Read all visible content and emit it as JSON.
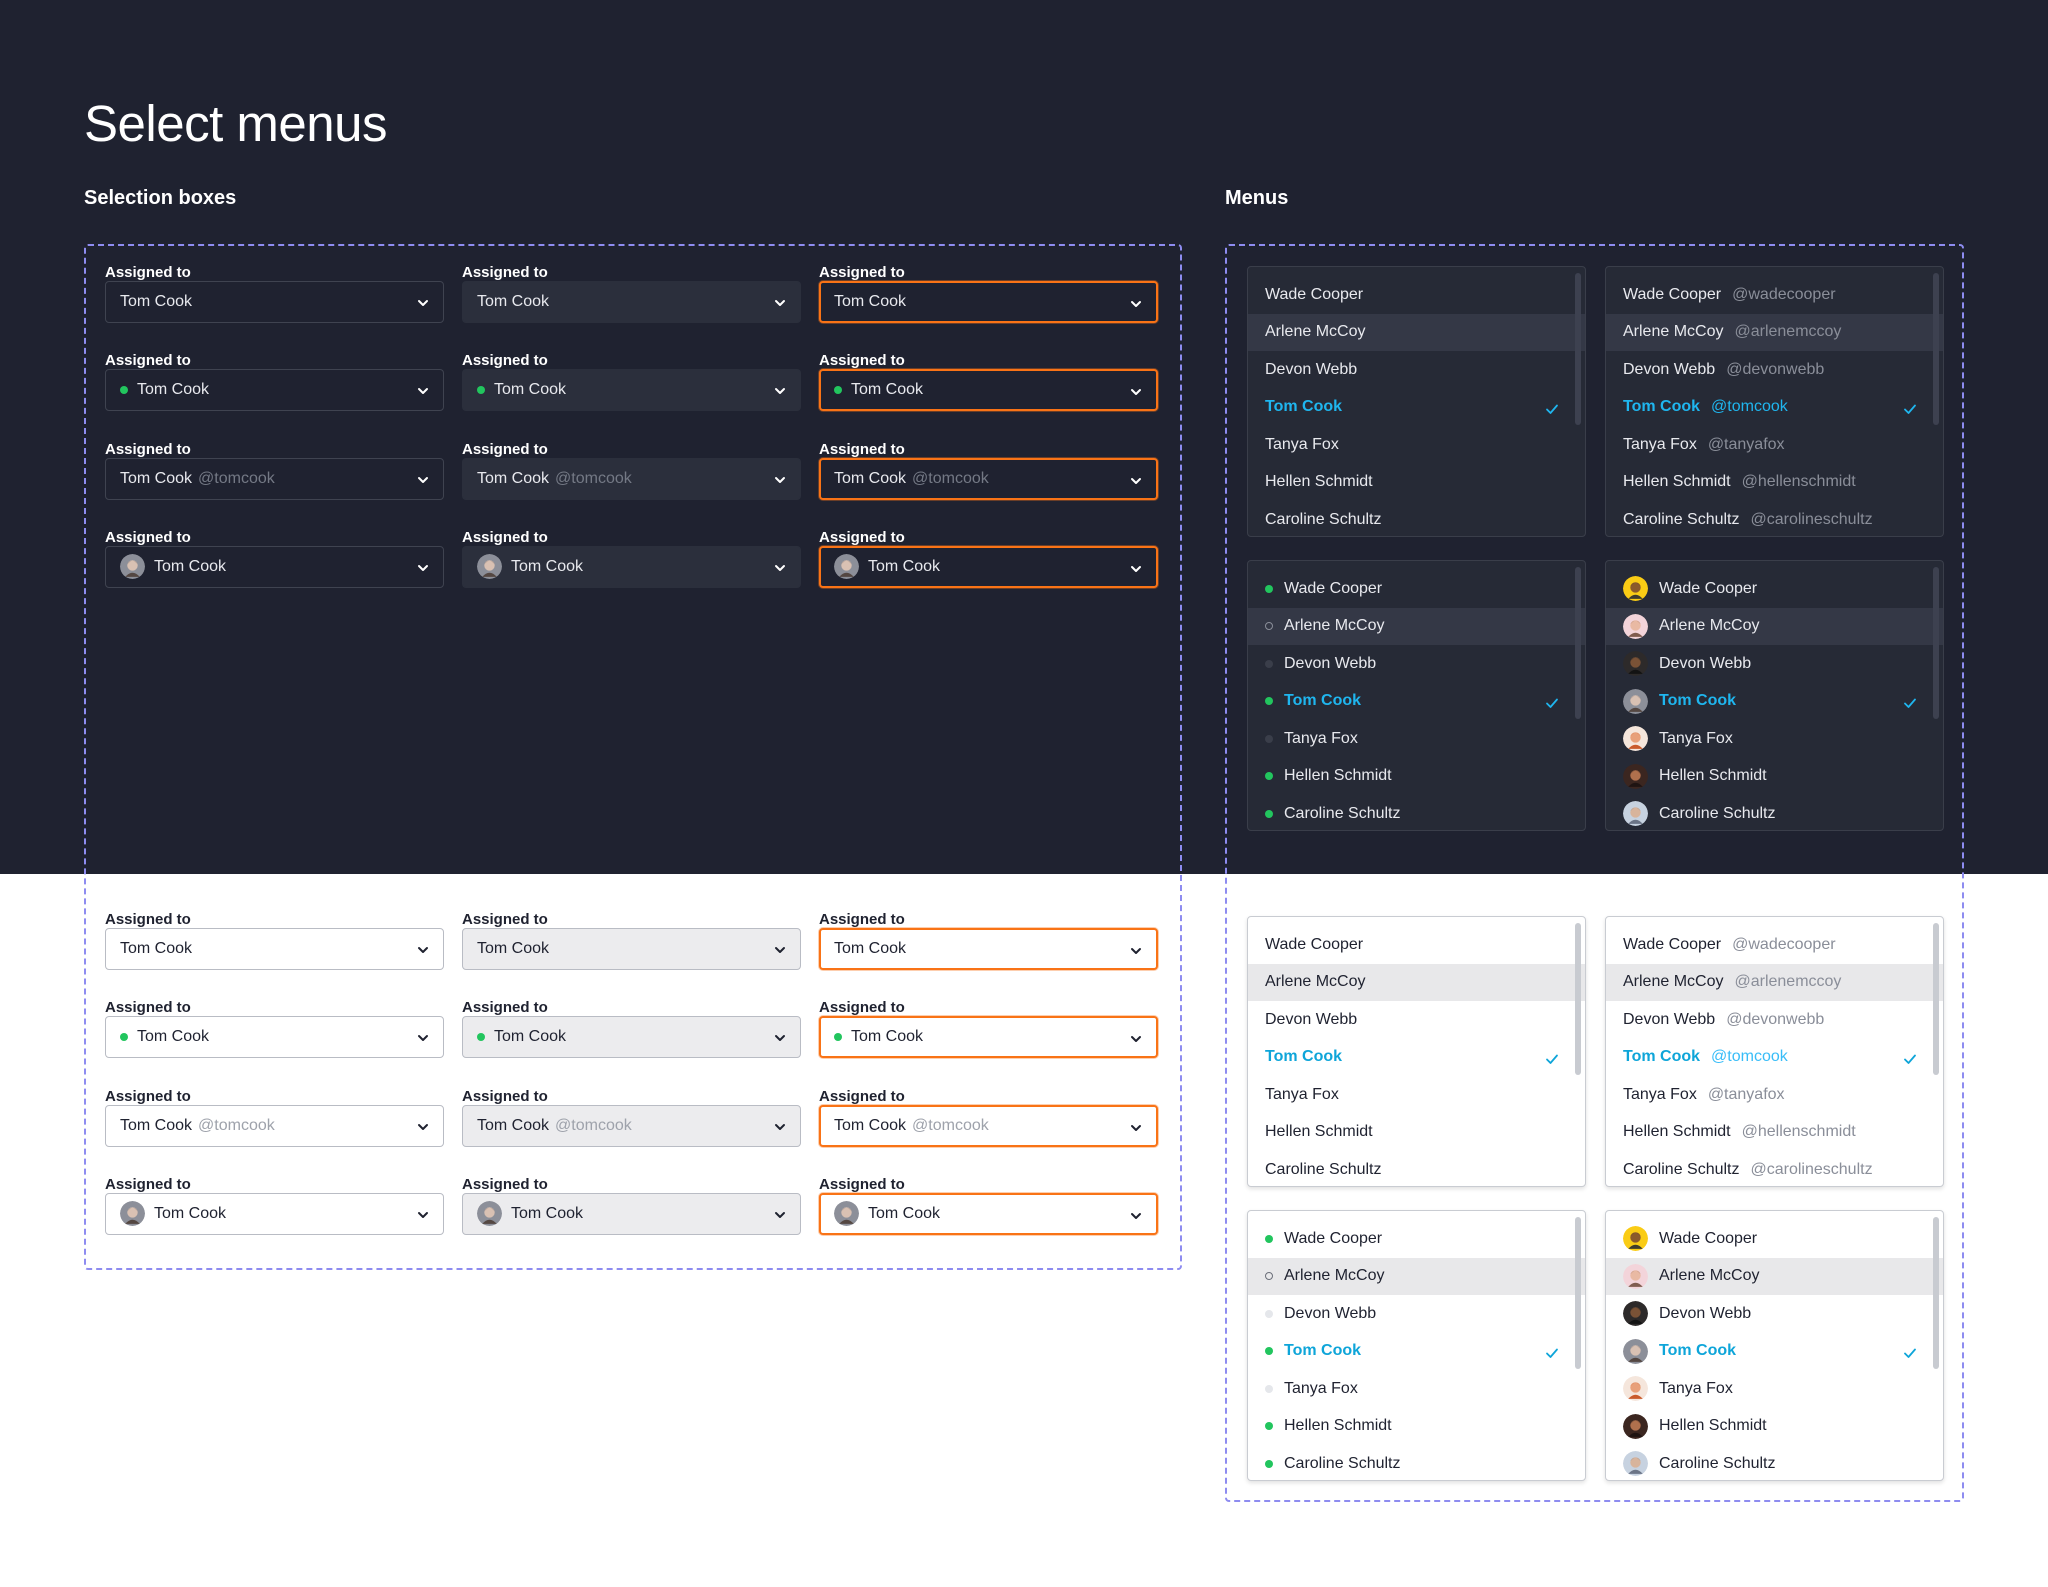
{
  "page": {
    "title": "Select menus"
  },
  "sections": {
    "selection_boxes": "Selection boxes",
    "menus": "Menus"
  },
  "colors": {
    "dark_bg": "#1f2230",
    "dark_fill": "#2b2f3c",
    "focus_ring": "#f97316",
    "online": "#22c55e",
    "selected_dark": "#1fb6ef",
    "selected_light": "#0ea5d9",
    "frame_dash": "#8e8cf0"
  },
  "field": {
    "label": "Assigned to",
    "value": "Tom Cook",
    "handle": "@tomcook"
  },
  "selection_rows": [
    {
      "variant": "plain"
    },
    {
      "variant": "status"
    },
    {
      "variant": "handle"
    },
    {
      "variant": "avatar"
    }
  ],
  "selection_columns": [
    {
      "state": "default"
    },
    {
      "state": "filled"
    },
    {
      "state": "focused"
    }
  ],
  "people": [
    {
      "name": "Wade Cooper",
      "handle": "@wadecooper",
      "online": true,
      "avatar": "yellow"
    },
    {
      "name": "Arlene McCoy",
      "handle": "@arlenemccoy",
      "online": false,
      "avatar": "pink"
    },
    {
      "name": "Devon Webb",
      "handle": "@devonwebb",
      "online": false,
      "avatar": "dark"
    },
    {
      "name": "Tom Cook",
      "handle": "@tomcook",
      "online": true,
      "avatar": "grey"
    },
    {
      "name": "Tanya Fox",
      "handle": "@tanyafox",
      "online": false,
      "avatar": "orange"
    },
    {
      "name": "Hellen Schmidt",
      "handle": "@hellenschmidt",
      "online": true,
      "avatar": "brown"
    },
    {
      "name": "Caroline Schultz",
      "handle": "@carolineschultz",
      "online": true,
      "avatar": "blue"
    }
  ],
  "menu_state": {
    "active_index": 1,
    "selected_index": 3,
    "ring_index": 1
  },
  "menu_variants": [
    "plain",
    "handle",
    "status",
    "avatar"
  ],
  "icons": {
    "chevron": "chevron-down-icon",
    "check": "check-icon",
    "avatar": "avatar-icon",
    "status": "status-dot-icon"
  }
}
